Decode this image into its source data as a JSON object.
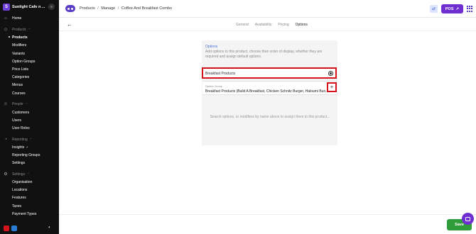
{
  "store": {
    "badge": "S",
    "name": "Sunlight Cafe n ...",
    "chevron": "⌄",
    "collapse": "«"
  },
  "sidebar": {
    "home": {
      "label": "Home",
      "icon": "home-icon"
    },
    "products_section": {
      "label": "Products",
      "icon": "tag-icon"
    },
    "products_items": [
      "Products",
      "Modifiers",
      "Variants",
      "Option Groups",
      "Price Lists",
      "Categories",
      "Menus",
      "Courses"
    ],
    "people_section": {
      "label": "People",
      "icon": "people-icon"
    },
    "people_items": [
      "Customers",
      "Users",
      "User Roles"
    ],
    "reporting_section": {
      "label": "Reporting",
      "icon": "reporting-icon"
    },
    "reporting_items": [
      "Insights",
      "Reporting Groups",
      "Settings"
    ],
    "settings_section": {
      "label": "Settings",
      "icon": "gear-icon"
    },
    "settings_items": [
      "Organisation",
      "Locations",
      "Features",
      "Taxes",
      "Payment Types"
    ],
    "bottom_colors": [
      "#d4141d",
      "#2a7bd4"
    ]
  },
  "header": {
    "breadcrumb": [
      "Products",
      "Manage",
      "Coffee And Breakfast Combo"
    ],
    "breadcrumb_sep": "/",
    "pos_label": "POS",
    "pos_arrow": "↗",
    "accent": "#6f2fd0"
  },
  "tabs": [
    "General",
    "Availability",
    "Pricing",
    "Options"
  ],
  "active_tab": "Options",
  "options": {
    "title": "Options",
    "description": "Add options to this product, choose their order of display, whether they are required and assign default options.",
    "search_value": "Breakfast Products",
    "option_group_label": "Option Group",
    "option_group_value": "Breakfast Products (Build A Breakfast, Chicken Schnitz Burger, Haloumi Bun, Breakfast",
    "add_symbol": "+",
    "empty_message": "Search options, or modifiers by name above to assign them to this product..."
  },
  "footer": {
    "save_label": "Save",
    "save_color": "#2f9e3a"
  }
}
